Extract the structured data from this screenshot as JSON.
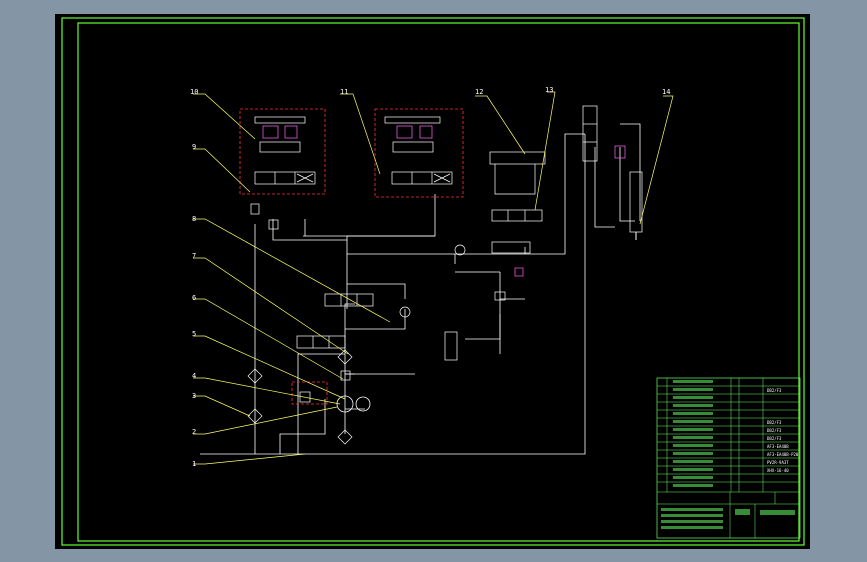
{
  "drawing": {
    "colors": {
      "background": "#000000",
      "frame": "#66ff33",
      "lines": "#ffffff",
      "leaders": "#ffff66",
      "dashed_box": "#ff3333",
      "valve_accent": "#ff66ff",
      "title_block": "#66ff66"
    },
    "callouts": [
      "1",
      "2",
      "3",
      "4",
      "5",
      "6",
      "7",
      "8",
      "9",
      "10",
      "11",
      "12",
      "13",
      "14"
    ],
    "title_block": {
      "right_column_codes": [
        "DB2/F3",
        "DB2/F3",
        "DB2/F3",
        "DB2/F3",
        "AF3-EA40B",
        "AF3-EA40B-P20",
        "PV2R-9A3T",
        "XHX-16-40"
      ]
    }
  }
}
